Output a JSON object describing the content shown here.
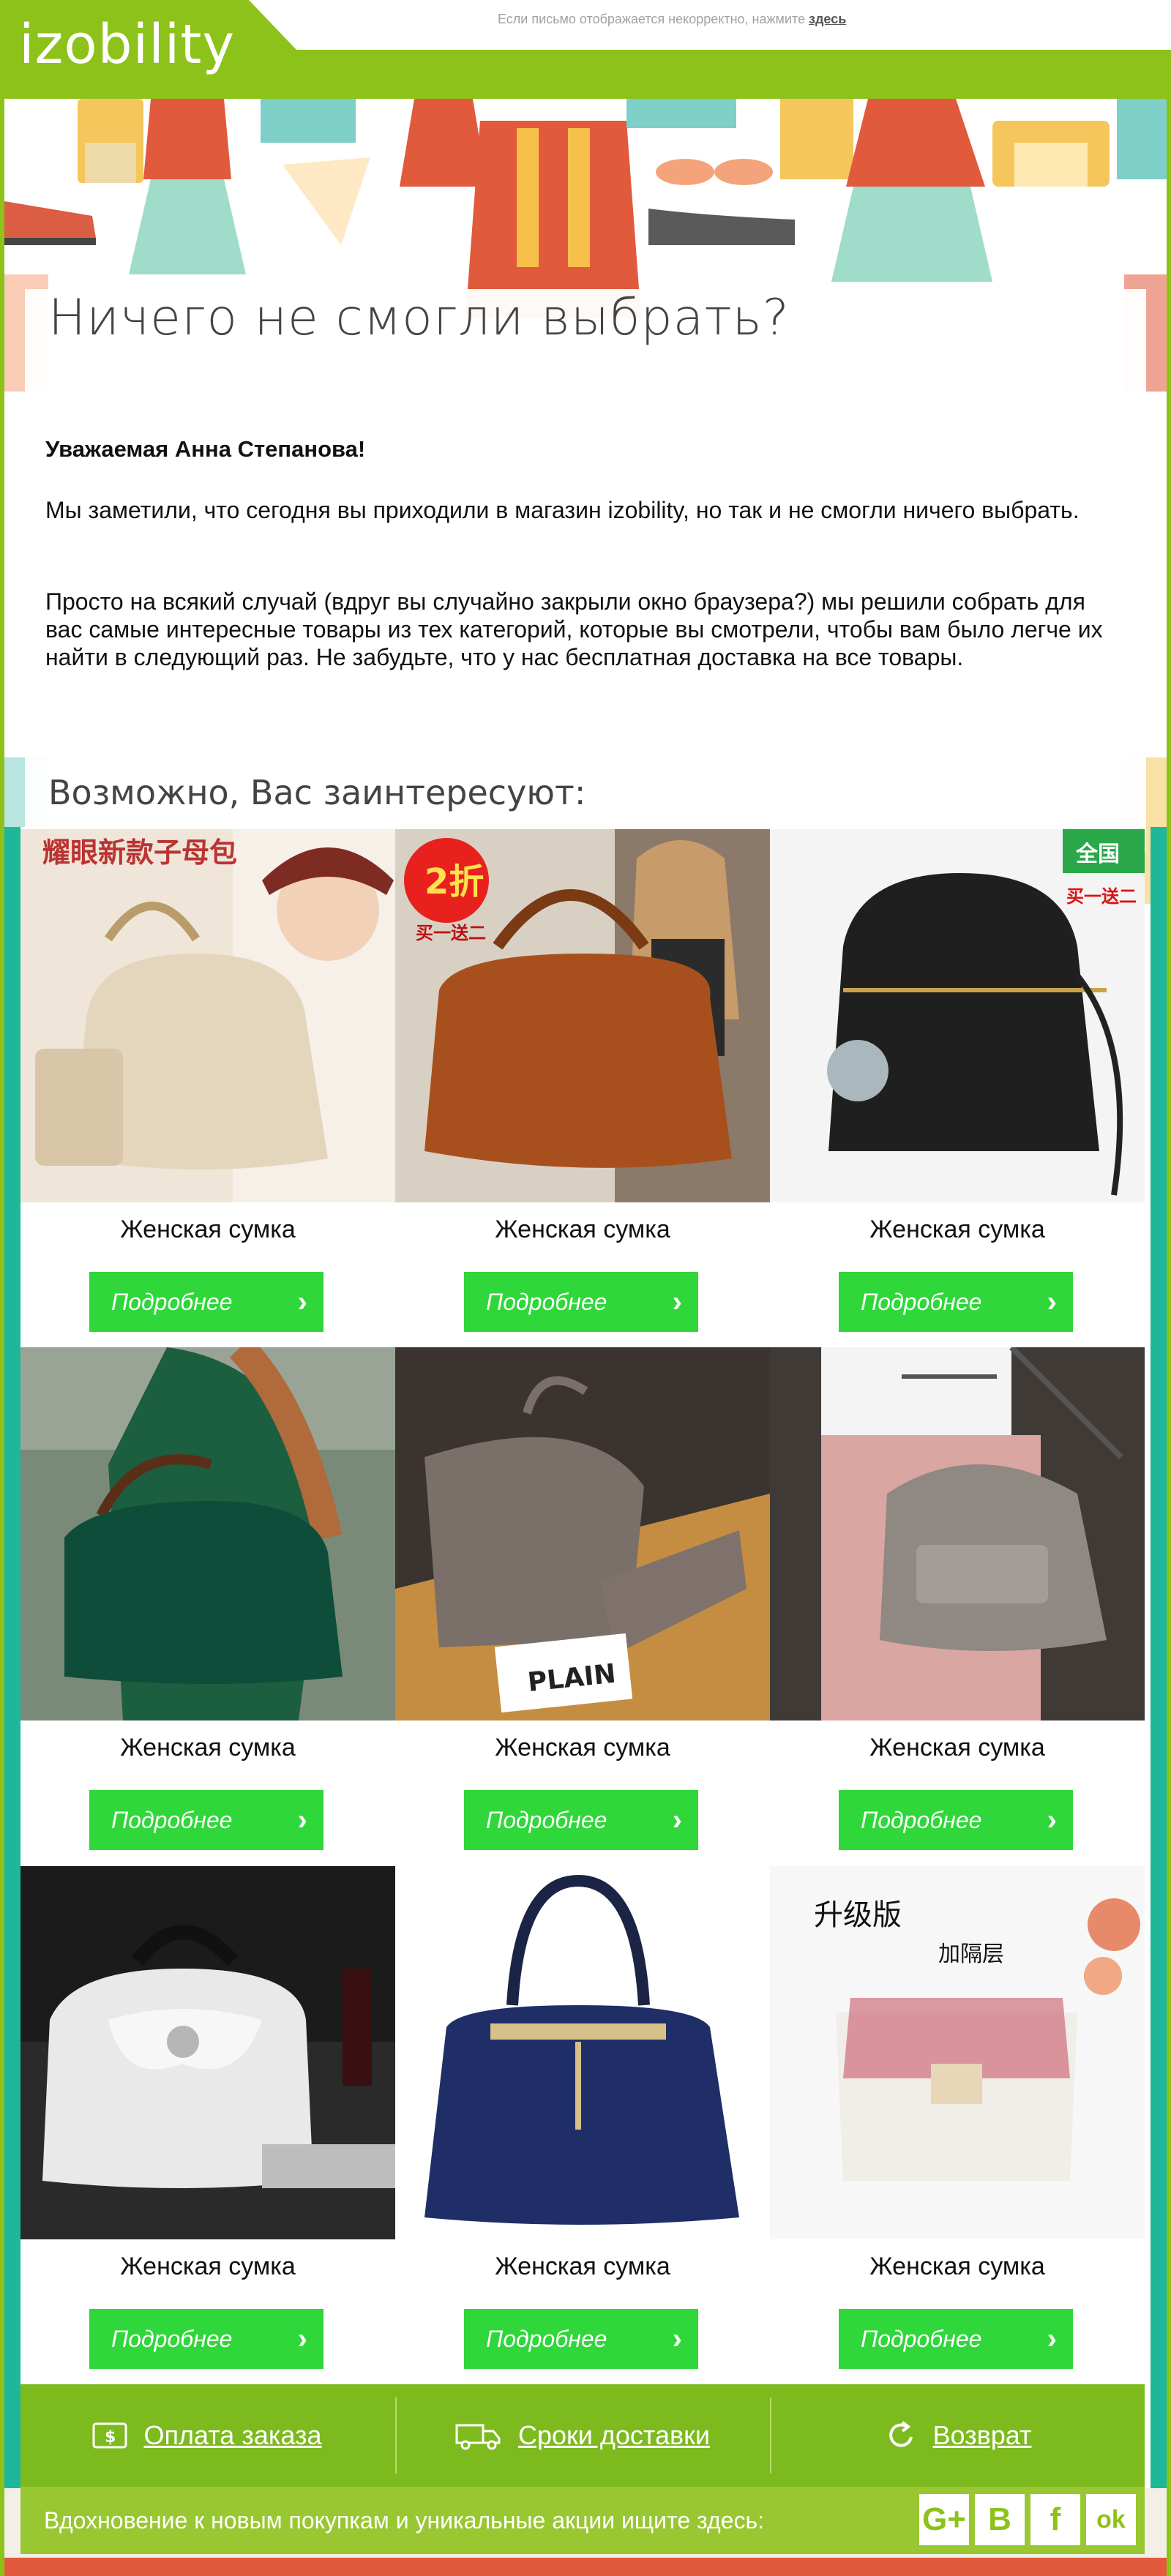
{
  "header": {
    "logo": "izobility",
    "notice_text": "Если письмо отображается некорректно, нажмите",
    "notice_link": "здесь"
  },
  "hero": {
    "headline": "Ничего не смогли выбрать?",
    "greeting": "Уважаемая Анна Степанова!",
    "paragraph1": "Мы заметили, что сегодня вы приходили в магазин izobility, но так и не смогли ничего выбрать.",
    "paragraph2": "Просто на всякий случай (вдруг вы случайно закрыли окно браузера?) мы решили собрать для вас самые интересные товары из тех категорий, которые вы смотрели, чтобы вам было легче их найти в следующий раз. Не забудьте, что у нас бесплатная доставка на все товары."
  },
  "products": {
    "heading": "Возможно, Вас заинтересуют:",
    "items": [
      {
        "name": "Женская сумка",
        "button": "Подробнее",
        "image_badge": "耀眼新款子母包"
      },
      {
        "name": "Женская сумка",
        "button": "Подробнее",
        "image_badge": "2折",
        "image_badge2": "买一送二"
      },
      {
        "name": "Женская сумка",
        "button": "Подробнее",
        "image_badge": "全国",
        "image_badge2": "买一送二"
      },
      {
        "name": "Женская сумка",
        "button": "Подробнее"
      },
      {
        "name": "Женская сумка",
        "button": "Подробнее",
        "image_badge": "PLAIN"
      },
      {
        "name": "Женская сумка",
        "button": "Подробнее"
      },
      {
        "name": "Женская сумка",
        "button": "Подробнее"
      },
      {
        "name": "Женская сумка",
        "button": "Подробнее"
      },
      {
        "name": "Женская сумка",
        "button": "Подробнее",
        "image_badge": "升级版",
        "image_badge2": "加隔层"
      }
    ]
  },
  "footer": {
    "links": [
      {
        "label": "Оплата заказа",
        "icon": "payment-icon"
      },
      {
        "label": "Сроки доставки",
        "icon": "truck-icon"
      },
      {
        "label": "Возврат",
        "icon": "return-icon"
      }
    ],
    "social_text": "Вдохновение к новым покупкам и уникальные акции ищите здесь:",
    "social": [
      {
        "label": "G+",
        "icon": "google-plus-icon"
      },
      {
        "label": "B",
        "icon": "vk-icon"
      },
      {
        "label": "f",
        "icon": "facebook-icon"
      },
      {
        "label": "ok",
        "icon": "odnoklassniki-icon"
      }
    ]
  },
  "colors": {
    "brand_green": "#8cc219",
    "button_green": "#2fd73a",
    "footer_green": "#7dba1e"
  }
}
